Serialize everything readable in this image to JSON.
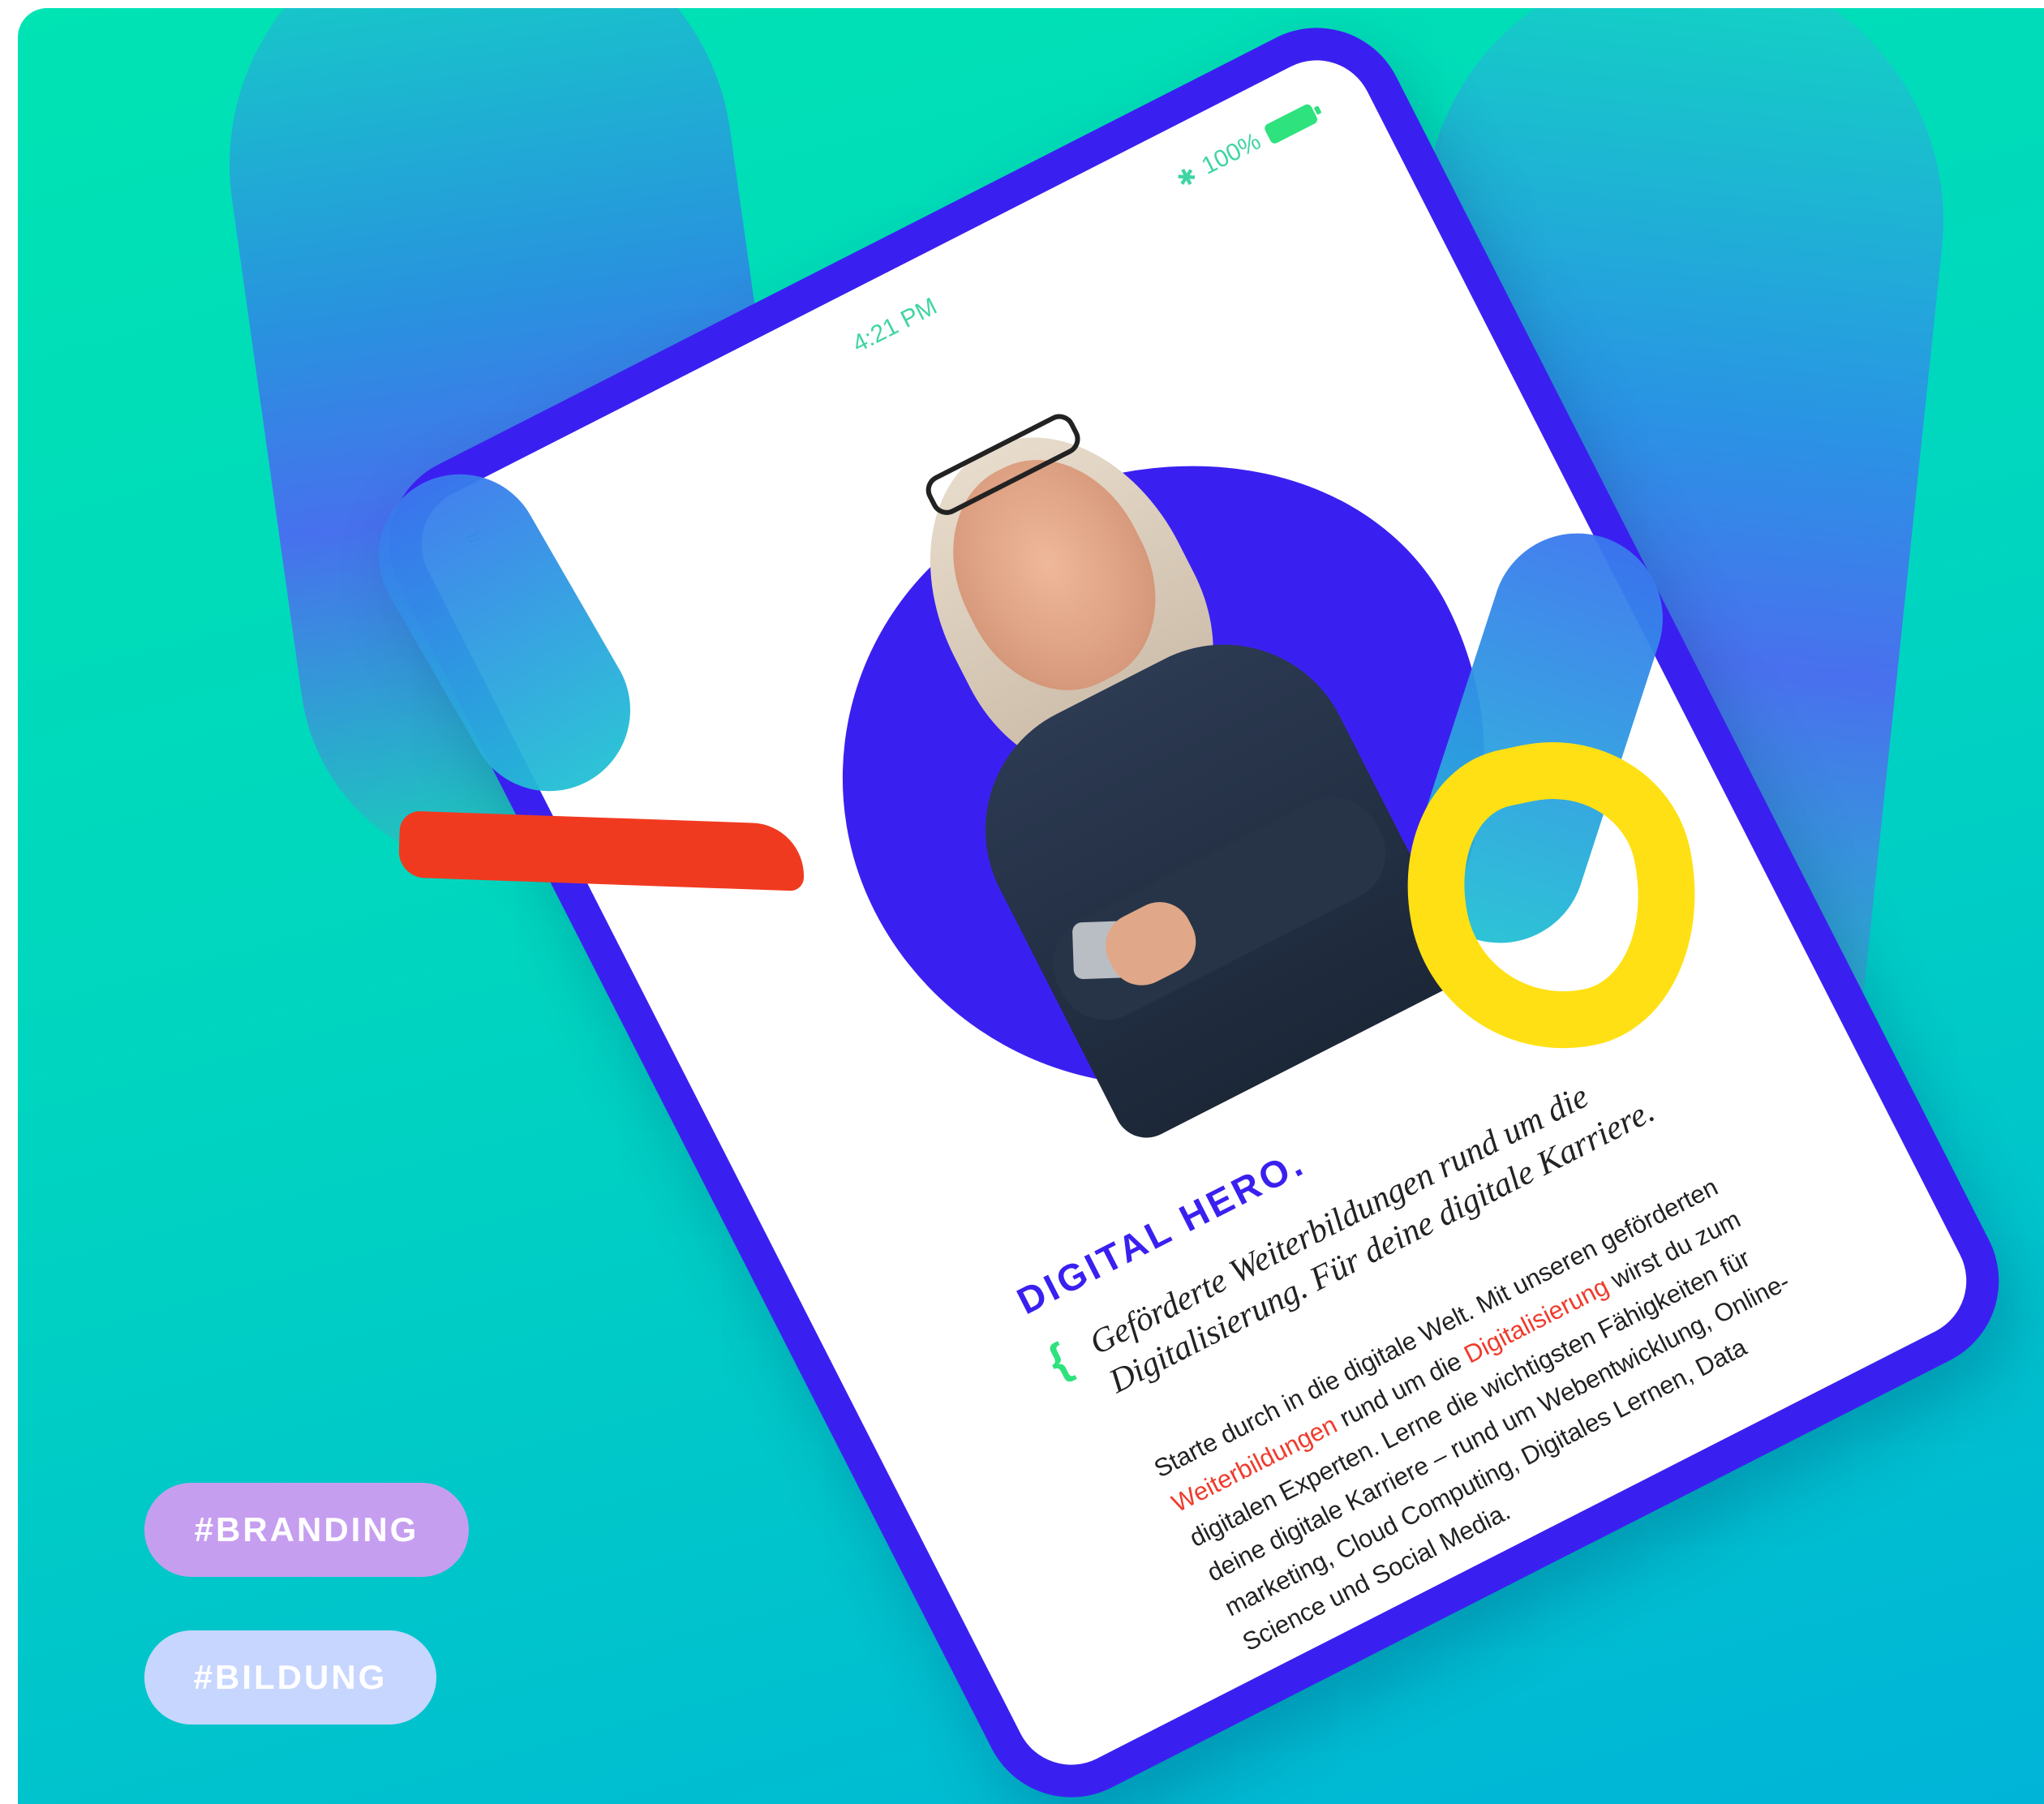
{
  "tablet": {
    "status_time": "4:21 PM",
    "battery_text": "100%",
    "icons": [
      "wifi-icon",
      "bluetooth-icon",
      "battery-icon"
    ]
  },
  "article": {
    "title": "DIGITAL HERO.",
    "brace_open": "{",
    "brace_close": "}",
    "lead": "Geförderte Weiterbildungen rund um die Digitalisierung. Für deine digitale Karriere.",
    "body_part1": "Starte durch in die digitale Welt. Mit unseren geförderten ",
    "body_link1": "Weiterbildungen",
    "body_part2": " rund um die ",
    "body_link2": "Digitalisierung",
    "body_part3": " wirst du zum digitalen Experten. Lerne die wichtigsten Fähigkeiten für deine digitale Karriere – rund um Webentwicklung, Online-marketing, Cloud Computing, Digitales Lernen, Data Science und Social Media."
  },
  "tags": [
    "#BRANDING",
    "#BILDUNG"
  ],
  "colors": {
    "background_top": "#00e3b3",
    "background_bottom": "#00b4d8",
    "brand_blue": "#3a20f0",
    "accent_red": "#f03a20",
    "accent_yellow": "#ffe014",
    "accent_green": "#2ee27e",
    "tag_branding": "#c69ef0",
    "tag_bildung": "#c7d6ff"
  }
}
